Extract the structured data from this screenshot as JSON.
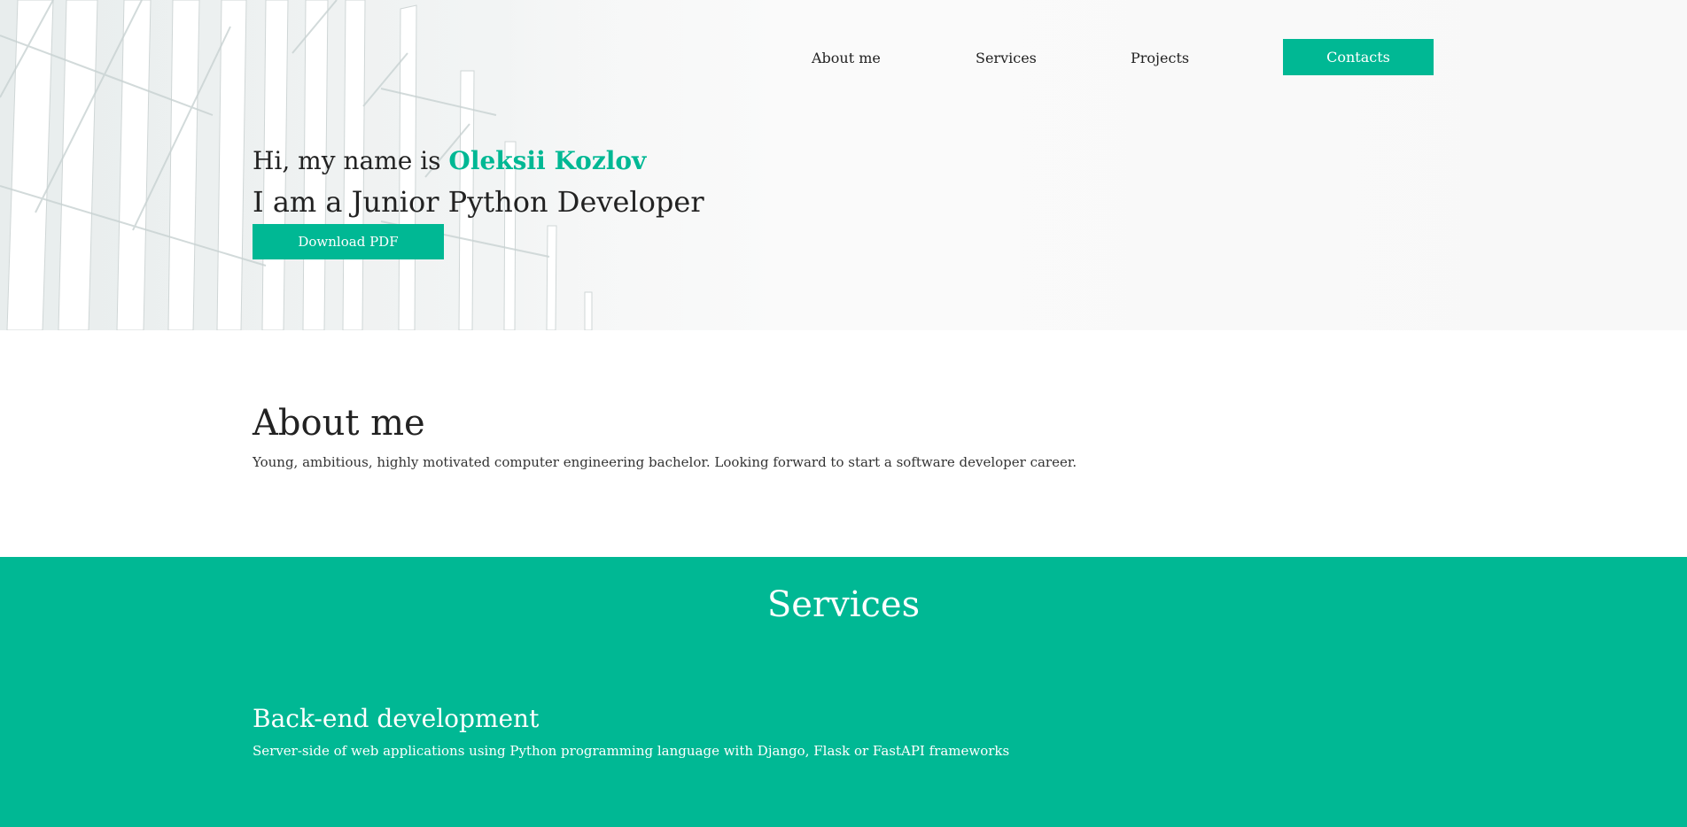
{
  "nav": {
    "about": "About me",
    "services": "Services",
    "projects": "Projects",
    "contacts": "Contacts"
  },
  "hero": {
    "greeting": "Hi, my name is ",
    "name": "Oleksii Kozlov",
    "role": "I am a Junior Python Developer",
    "download": "Download PDF"
  },
  "about": {
    "title": "About me",
    "text": "Young, ambitious, highly motivated computer engineering bachelor. Looking forward to start a software developer career."
  },
  "services": {
    "title": "Services",
    "items": [
      {
        "title": "Back-end development",
        "description": "Server-side of web applications using Python programming language with Django, Flask or FastAPI frameworks"
      }
    ]
  },
  "colors": {
    "accent": "#00b894",
    "text": "#222222",
    "background": "#ffffff"
  }
}
